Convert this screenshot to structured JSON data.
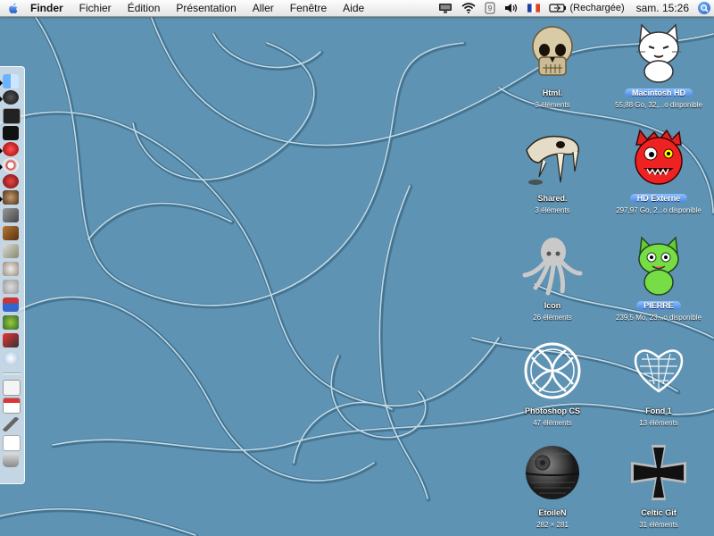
{
  "menubar": {
    "app_name": "Finder",
    "items": [
      "Fichier",
      "Édition",
      "Présentation",
      "Aller",
      "Fenêtre",
      "Aide"
    ],
    "battery_status": "(Rechargée)",
    "clock": "sam. 15:26",
    "icons": [
      "apple-icon",
      "display-icon",
      "wifi-icon",
      "sync-icon",
      "volume-icon",
      "flag-fr-icon",
      "battery-icon",
      "spotlight-icon"
    ]
  },
  "desktop": {
    "icons": [
      {
        "name": "Html.",
        "info": "3 éléments",
        "selected": false,
        "icon": "skull-icon"
      },
      {
        "name": "Macintosh HD",
        "info": "55,88 Go, 32,...o disponible",
        "selected": true,
        "icon": "white-cat-icon"
      },
      {
        "name": "Shared.",
        "info": "3 éléments",
        "selected": false,
        "icon": "sabertooth-skull-icon"
      },
      {
        "name": "HD Externe",
        "info": "297,97 Go, 2...o disponible",
        "selected": true,
        "icon": "red-monster-icon"
      },
      {
        "name": "Icon",
        "info": "26 éléments",
        "selected": false,
        "icon": "octopus-icon"
      },
      {
        "name": "PIERRE",
        "info": "239,5 Mo, 23...o disponible",
        "selected": true,
        "icon": "green-cat-icon"
      },
      {
        "name": "Photoshop CS",
        "info": "47 éléments",
        "selected": false,
        "icon": "celtic-knot-icon"
      },
      {
        "name": "Fond 1",
        "info": "13 éléments",
        "selected": false,
        "icon": "lace-heart-icon"
      },
      {
        "name": "EtoileN",
        "info": "282 × 281",
        "selected": false,
        "icon": "death-star-icon"
      },
      {
        "name": "Celtic Gif",
        "info": "31 éléments",
        "selected": false,
        "icon": "iron-cross-icon"
      }
    ]
  },
  "dock": {
    "items": [
      "finder-icon",
      "dashboard-icon",
      "terminal-icon",
      "pirate-flag-icon",
      "red-ball-icon",
      "eyeball-icon",
      "itunes-icon",
      "monkey-icon",
      "tools-icon",
      "dragon-icon",
      "bones-icon",
      "skull-icon",
      "cat-icon",
      "toolbox-icon",
      "bug-icon",
      "rocket-icon",
      "gear-icon",
      "document-icon",
      "calendar-icon",
      "pen-icon",
      "text-file-icon",
      "trash-icon"
    ]
  }
}
